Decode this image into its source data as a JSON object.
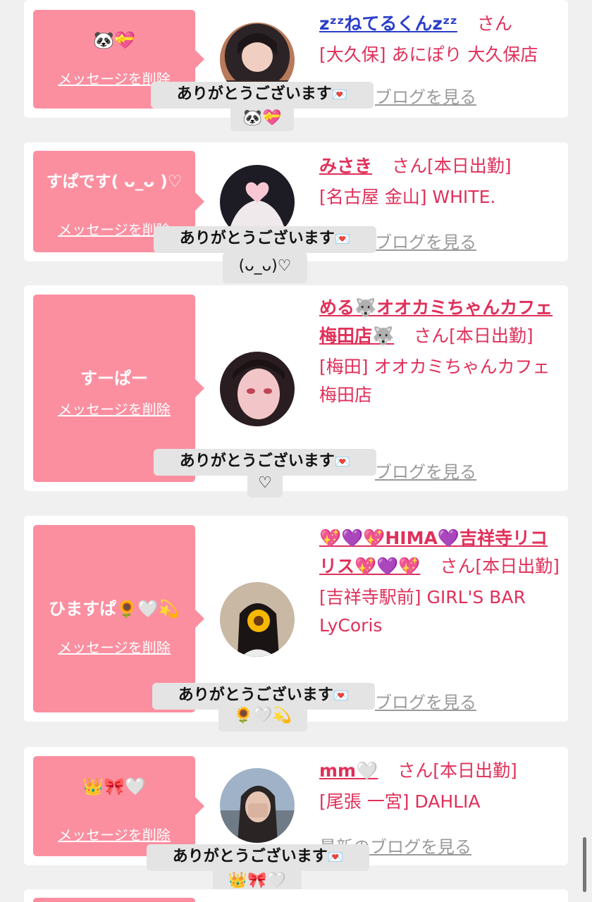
{
  "cards": [
    {
      "message": "🐼💝",
      "delete_label": "メッセージを削除",
      "name": "zᶻᶻねてるくんzᶻᶻ",
      "san": "さん",
      "shop": "[大久保] あにぽり 大久保店",
      "blog_label": "ブログを見る",
      "tip_title": "ありがとうございます",
      "tip_body": "🐼💝"
    },
    {
      "message": "すぱです( ᴗ_ᴗ )♡",
      "delete_label": "メッセージを削除",
      "name": "みさき",
      "san": "さん[本日出勤]",
      "shop": "[名古屋 金山] WHITE.",
      "blog_label": "ブログを見る",
      "tip_title": "ありがとうございます",
      "tip_body": "(ᴗ_ᴗ)♡"
    },
    {
      "message": "すーぱー",
      "delete_label": "メッセージを削除",
      "name": "める🐺オオカミちゃんカフェ梅田店🐺",
      "san": "さん[本日出勤]",
      "shop": "[梅田] オオカミちゃんカフェ梅田店",
      "blog_label": "ブログを見る",
      "tip_title": "ありがとうございます",
      "tip_body": "♡"
    },
    {
      "message": "ひますぱ🌻🤍💫",
      "delete_label": "メッセージを削除",
      "name": "💖💜💖HIMA💜吉祥寺リコリス💖💜💖",
      "san": "さん[本日出勤]",
      "shop": "[吉祥寺駅前] GIRL'S BAR LyCoris",
      "blog_label": "ブログを見る",
      "tip_title": "ありがとうございます",
      "tip_body": "🌻🤍💫"
    },
    {
      "message": "👑🎀🤍",
      "delete_label": "メッセージを削除",
      "name": "mm🤍",
      "san": "さん[本日出勤]",
      "shop": "[尾張 一宮] DAHLIA",
      "blog_label": "最新のブログを見る",
      "tip_title": "ありがとうございます",
      "tip_body": "👑🎀🤍"
    }
  ],
  "icons": {
    "envelope": "💌"
  },
  "colors": {
    "bubble": "#fb8fa0",
    "accent": "#e0305a",
    "background": "#f0f0f0",
    "tooltip": "#e4e4e4"
  }
}
